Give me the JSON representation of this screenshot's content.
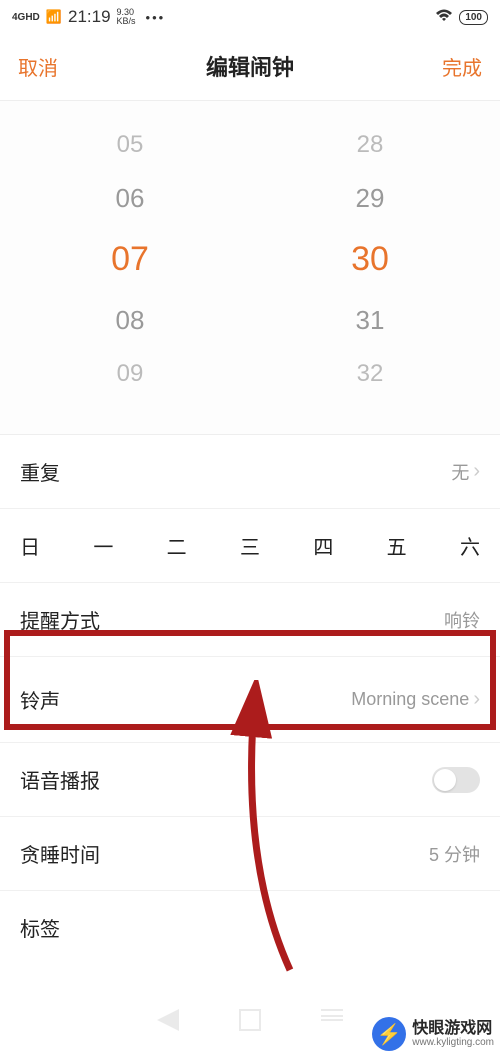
{
  "status": {
    "network": "4GHD",
    "time": "21:19",
    "speed_top": "9.30",
    "speed_bot": "KB/s",
    "dots": "•••",
    "battery": "100"
  },
  "nav": {
    "cancel": "取消",
    "title": "编辑闹钟",
    "done": "完成"
  },
  "picker": {
    "hours": [
      "05",
      "06",
      "07",
      "08",
      "09"
    ],
    "minutes": [
      "28",
      "29",
      "30",
      "31",
      "32"
    ],
    "selected_hour": "07",
    "selected_minute": "30"
  },
  "rows": {
    "repeat": {
      "label": "重复",
      "value": "无"
    },
    "weekdays": [
      "日",
      "一",
      "二",
      "三",
      "四",
      "五",
      "六"
    ],
    "remind": {
      "label": "提醒方式",
      "value": "响铃"
    },
    "ringtone": {
      "label": "铃声",
      "value": "Morning scene"
    },
    "voice": {
      "label": "语音播报"
    },
    "snooze": {
      "label": "贪睡时间",
      "value": "5 分钟"
    },
    "tag": {
      "label": "标签"
    }
  },
  "watermark": {
    "title": "快眼游戏网",
    "url": "www.kyligting.com"
  }
}
